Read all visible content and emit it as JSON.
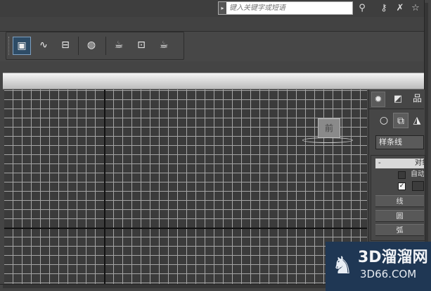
{
  "search": {
    "placeholder": "键入关键字或短语",
    "arrow": "▸"
  },
  "top_icons": [
    {
      "name": "binoculars-icon",
      "glyph": "⚲"
    },
    {
      "name": "key-icon",
      "glyph": "⚷"
    },
    {
      "name": "comm-center-icon",
      "glyph": "✗"
    },
    {
      "name": "favorites-icon",
      "glyph": "☆"
    }
  ],
  "toolbar": {
    "buttons": [
      {
        "name": "scene-explorer-button",
        "glyph": "▣",
        "active": true
      },
      {
        "name": "curve-editor-button",
        "glyph": "∿",
        "active": false
      },
      {
        "name": "schematic-view-button",
        "glyph": "⊟",
        "active": false
      },
      {
        "name": "material-editor-button",
        "glyph": "◍",
        "active": false
      },
      {
        "name": "render-setup-button",
        "glyph": "☕",
        "active": false
      },
      {
        "name": "rendered-frame-window-button",
        "glyph": "⊡",
        "active": false
      },
      {
        "name": "render-production-button",
        "glyph": "☕",
        "active": false
      }
    ]
  },
  "viewport": {
    "viewcube_label": "前"
  },
  "panel": {
    "tabs": [
      {
        "name": "tab-create",
        "glyph": "✹",
        "active": true
      },
      {
        "name": "tab-modify",
        "glyph": "◩",
        "active": false
      },
      {
        "name": "tab-hierarchy",
        "glyph": "品",
        "active": false
      }
    ],
    "categories": [
      {
        "name": "category-geometry",
        "glyph": "○",
        "active": false
      },
      {
        "name": "category-shapes",
        "glyph": "⧉",
        "active": true
      },
      {
        "name": "category-lights",
        "glyph": "◮",
        "active": false
      }
    ],
    "dropdown_value": "样条线",
    "rollout": {
      "collapse": "-",
      "title": "对象类型",
      "auto_grid": "自动栅格",
      "start_new_shape_checked": "✓",
      "object_buttons": [
        "线",
        "圆",
        "弧"
      ]
    }
  },
  "watermark": {
    "title": "3D溜溜网",
    "url": "3D66.COM"
  },
  "colors": {
    "active_button": "#2e4c66",
    "grid_line": "#a5a5a5",
    "watermark_bg": "#1f3754"
  }
}
